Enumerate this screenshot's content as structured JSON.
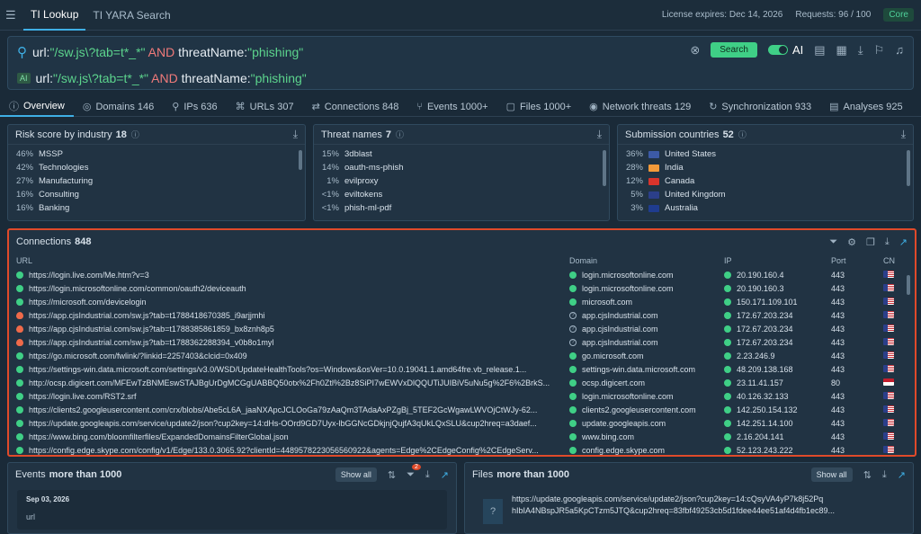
{
  "topbar": {
    "tabs": [
      "TI Lookup",
      "TI YARA Search"
    ],
    "license": "License expires: Dec 14, 2026",
    "requests": "Requests: 96 / 100",
    "plan": "Core"
  },
  "search": {
    "query_parts": [
      {
        "t": "url:",
        "c": "qtx"
      },
      {
        "t": "\"/sw.js\\?tab=t*_*\"",
        "c": "qstr"
      },
      {
        "t": " AND ",
        "c": "qkw"
      },
      {
        "t": "threatName:",
        "c": "qtx"
      },
      {
        "t": "\"phishing\"",
        "c": "qstr"
      }
    ],
    "ai_chip": "AI",
    "button": "Search",
    "ai_label": "AI"
  },
  "tabs": [
    {
      "label": "Overview",
      "icon": "ⓘ"
    },
    {
      "label": "Domains 146",
      "icon": "◎"
    },
    {
      "label": "IPs 636",
      "icon": "⚲"
    },
    {
      "label": "URLs 307",
      "icon": "⌘"
    },
    {
      "label": "Connections 848",
      "icon": "⇄"
    },
    {
      "label": "Events 1000+",
      "icon": "⑂"
    },
    {
      "label": "Files 1000+",
      "icon": "▢"
    },
    {
      "label": "Network threats 129",
      "icon": "◉"
    },
    {
      "label": "Synchronization 933",
      "icon": "↻"
    },
    {
      "label": "Analyses 925",
      "icon": "▤"
    }
  ],
  "risk": {
    "title": "Risk score by industry",
    "count": "18",
    "rows": [
      [
        "46%",
        "MSSP"
      ],
      [
        "42%",
        "Technologies"
      ],
      [
        "27%",
        "Manufacturing"
      ],
      [
        "16%",
        "Consulting"
      ],
      [
        "16%",
        "Banking"
      ]
    ]
  },
  "threats": {
    "title": "Threat names",
    "count": "7",
    "rows": [
      [
        "15%",
        "3dblast"
      ],
      [
        "14%",
        "oauth-ms-phish"
      ],
      [
        "1%",
        "evilproxy"
      ],
      [
        "<1%",
        "eviltokens"
      ],
      [
        "<1%",
        "phish-ml-pdf"
      ]
    ]
  },
  "countries": {
    "title": "Submission countries",
    "count": "52",
    "rows": [
      [
        "36%",
        "United States",
        "#3c5aa6"
      ],
      [
        "28%",
        "India",
        "#f29a3a"
      ],
      [
        "12%",
        "Canada",
        "#d8342c"
      ],
      [
        "5%",
        "United Kingdom",
        "#2b3f8a"
      ],
      [
        "3%",
        "Australia",
        "#1f3c8f"
      ]
    ]
  },
  "connections": {
    "title": "Connections",
    "count": "848",
    "headers": [
      "URL",
      "Domain",
      "IP",
      "Port",
      "CN"
    ],
    "rows": [
      [
        "ok",
        "https://login.live.com/Me.htm?v=3",
        "ok",
        "login.microsoftonline.com",
        "20.190.160.4",
        "443"
      ],
      [
        "ok",
        "https://login.microsoftonline.com/common/oauth2/deviceauth",
        "ok",
        "login.microsoftonline.com",
        "20.190.160.3",
        "443"
      ],
      [
        "ok",
        "https://microsoft.com/devicelogin",
        "ok",
        "microsoft.com",
        "150.171.109.101",
        "443"
      ],
      [
        "fire",
        "https://app.cjsIndustrial.com/sw.js?tab=t1788418670385_i9arjjmhi",
        "q",
        "app.cjsIndustrial.com",
        "172.67.203.234",
        "443"
      ],
      [
        "fire",
        "https://app.cjsIndustrial.com/sw.js?tab=t1788385861859_bx8znh8p5",
        "q",
        "app.cjsIndustrial.com",
        "172.67.203.234",
        "443"
      ],
      [
        "fire",
        "https://app.cjsIndustrial.com/sw.js?tab=t1788362288394_v0b8o1myl",
        "q",
        "app.cjsIndustrial.com",
        "172.67.203.234",
        "443"
      ],
      [
        "ok",
        "https://go.microsoft.com/fwlink/?linkid=2257403&clcid=0x409",
        "ok",
        "go.microsoft.com",
        "2.23.246.9",
        "443"
      ],
      [
        "ok",
        "https://settings-win.data.microsoft.com/settings/v3.0/WSD/UpdateHealthTools?os=Windows&osVer=10.0.19041.1.amd64fre.vb_release.1...",
        "ok",
        "settings-win.data.microsoft.com",
        "48.209.138.168",
        "443"
      ],
      [
        "ok",
        "http://ocsp.digicert.com/MFEwTzBNMEswSTAJBgUrDgMCGgUABBQ50otx%2Fh0Ztl%2Bz8SiPI7wEWVxDlQQUTiJUIBiV5uNu5g%2F6%2BrkS...",
        "ok",
        "ocsp.digicert.com",
        "23.11.41.157",
        "80"
      ],
      [
        "ok",
        "https://login.live.com/RST2.srf",
        "ok",
        "login.microsoftonline.com",
        "40.126.32.133",
        "443"
      ],
      [
        "ok",
        "https://clients2.googleusercontent.com/crx/blobs/Abe5cL6A_jaaNXApcJCLOoGa79zAaQm3TAdaAxPZgBj_5TEF2GcWgawLWVOjCtWJy-62...",
        "ok",
        "clients2.googleusercontent.com",
        "142.250.154.132",
        "443"
      ],
      [
        "ok",
        "https://update.googleapis.com/service/update2/json?cup2key=14:dHs-OOrd9GD7Uyx-lbGGNcGDkjnjQujfA3qUkLQxSLU&cup2hreq=a3daef...",
        "ok",
        "update.googleapis.com",
        "142.251.14.100",
        "443"
      ],
      [
        "ok",
        "https://www.bing.com/bloomfilterfiles/ExpandedDomainsFilterGlobal.json",
        "ok",
        "www.bing.com",
        "2.16.204.141",
        "443"
      ],
      [
        "ok",
        "https://config.edge.skype.com/config/v1/Edge/133.0.3065.92?clientId=4489578223056560922&agents=Edge%2CEdgeConfig%2CEdgeServ...",
        "ok",
        "config.edge.skype.com",
        "52.123.243.222",
        "443"
      ]
    ]
  },
  "events": {
    "title": "Events",
    "count": "more than 1000",
    "show_all": "Show all",
    "badge": "2",
    "date": "Sep 03, 2026",
    "first_item": "url"
  },
  "files": {
    "title": "Files",
    "count": "more than 1000",
    "show_all": "Show all",
    "first_item": "https://update.googleapis.com/service/update2/json?cup2key=14:cQsyVA4yP7k8j52Pq hIbIA4NBspJR5a5KpCTzm5JTQ&cup2hreq=83fbf49253cb5d1fdee44ee51af4d4fb1ec89..."
  }
}
